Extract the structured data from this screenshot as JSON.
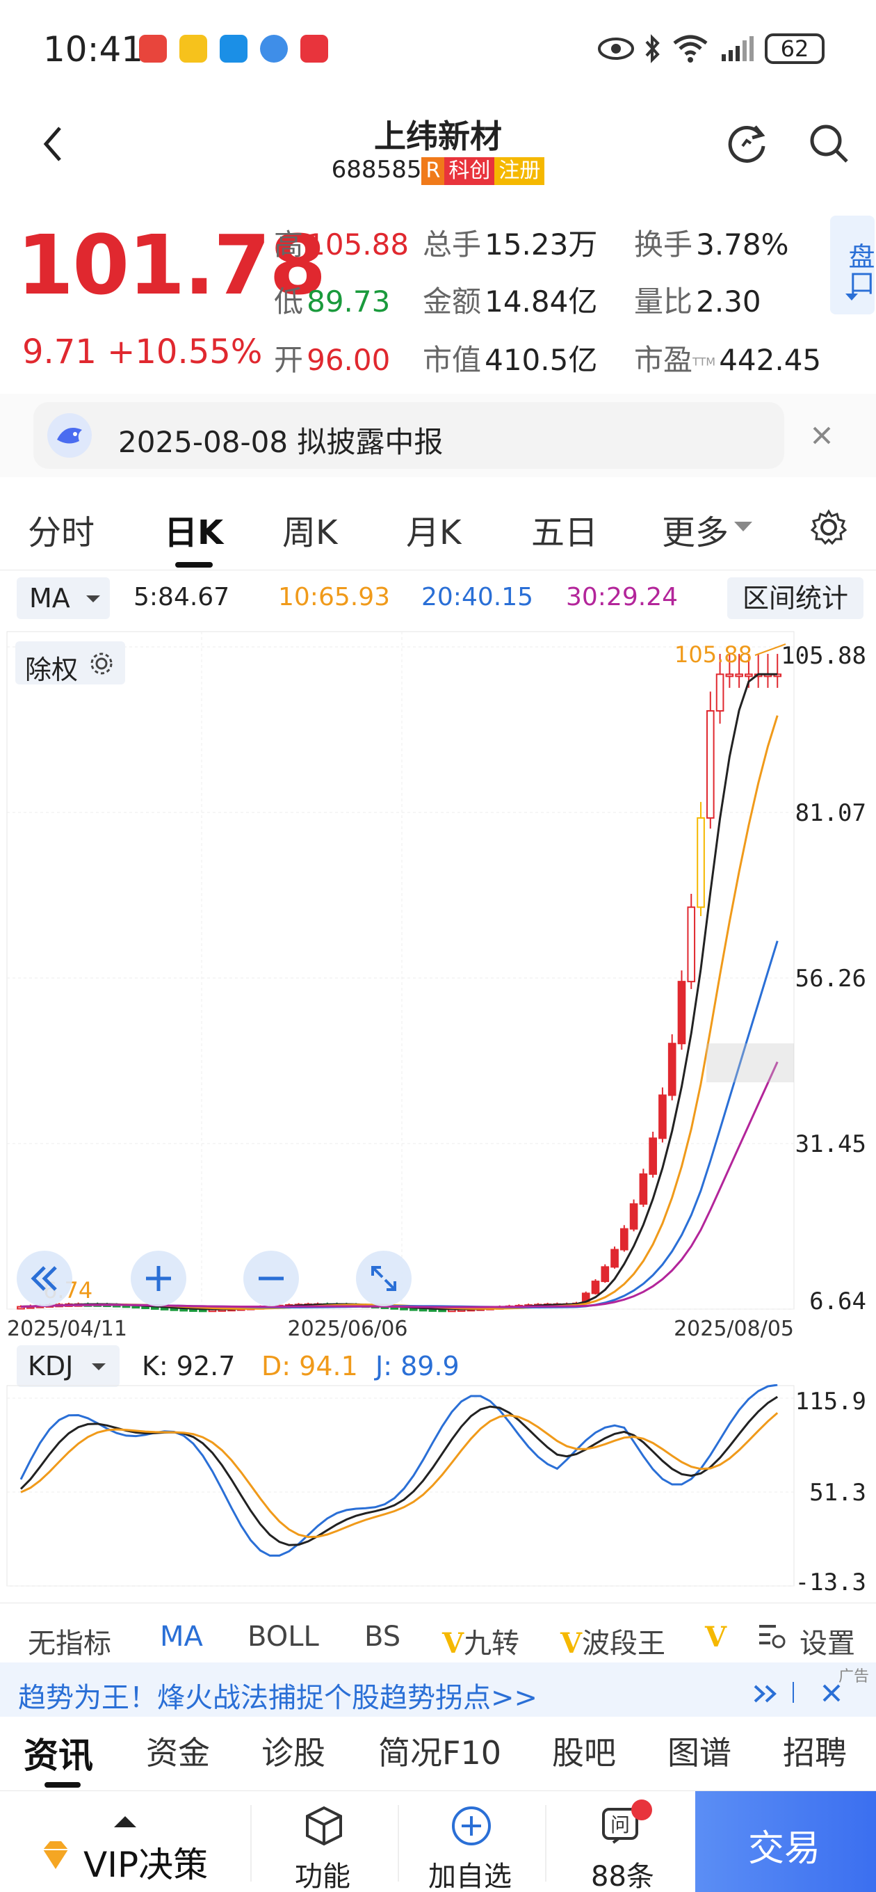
{
  "status_bar": {
    "time": "10:41",
    "battery": "62"
  },
  "header": {
    "title": "上纬新材",
    "code": "688585",
    "tag_r": "R",
    "tag_kc": "科创",
    "tag_zc": "注册"
  },
  "quote": {
    "price": "101.78",
    "change": "9.71",
    "change_pct": "+10.55%",
    "high_label": "高",
    "high": "105.88",
    "low_label": "低",
    "low": "89.73",
    "open_label": "开",
    "open": "96.00",
    "vol_label": "总手",
    "vol": "15.23万",
    "amount_label": "金额",
    "amount": "14.84亿",
    "mcap_label": "市值",
    "mcap": "410.5亿",
    "turnover_label": "换手",
    "turnover": "3.78%",
    "ratio_label": "量比",
    "ratio": "2.30",
    "pe_label": "市盈",
    "pe_sup": "TTM",
    "pe": "442.45",
    "panel_label": "盘口"
  },
  "notice": {
    "text": "2025-08-08 拟披露中报"
  },
  "tabs": [
    "分时",
    "日K",
    "周K",
    "月K",
    "五日",
    "更多"
  ],
  "ma": {
    "selector": "MA",
    "ma5": "5:84.67",
    "ma10": "10:65.93",
    "ma20": "20:40.15",
    "ma30": "30:29.24",
    "stats_button": "区间统计"
  },
  "chart_label": "除权",
  "chart_data": {
    "type": "candlestick",
    "y_ticks": [
      "105.88",
      "81.07",
      "56.26",
      "31.45",
      "6.64"
    ],
    "ylim": [
      6.64,
      105.88
    ],
    "x_ticks": [
      "2025/04/11",
      "2025/06/06",
      "2025/08/05"
    ],
    "max_label": "105.88",
    "min_label": "6.74",
    "colors": {
      "up": "#e0282f",
      "limit": "#f5b800",
      "ma5": "#222222",
      "ma10": "#f09a1a",
      "ma20": "#2a6fd6",
      "ma30": "#b3259a"
    }
  },
  "kdj": {
    "selector": "KDJ",
    "k": "K: 92.7",
    "d": "D: 94.1",
    "j": "J: 89.9",
    "y_ticks": [
      "115.9",
      "51.3",
      "-13.3"
    ]
  },
  "indicators": [
    "无指标",
    "MA",
    "BOLL",
    "BS",
    "九转",
    "波段王",
    "设置"
  ],
  "ad": {
    "text": "趋势为王！烽火战法捕捉个股趋势拐点>>",
    "badge": "广告"
  },
  "bottom_tabs": [
    "资讯",
    "资金",
    "诊股",
    "简况F10",
    "股吧",
    "图谱",
    "招聘"
  ],
  "bottom_nav": {
    "vip": "VIP决策",
    "func": "功能",
    "add": "加自选",
    "ask": "88条",
    "trade": "交易"
  }
}
